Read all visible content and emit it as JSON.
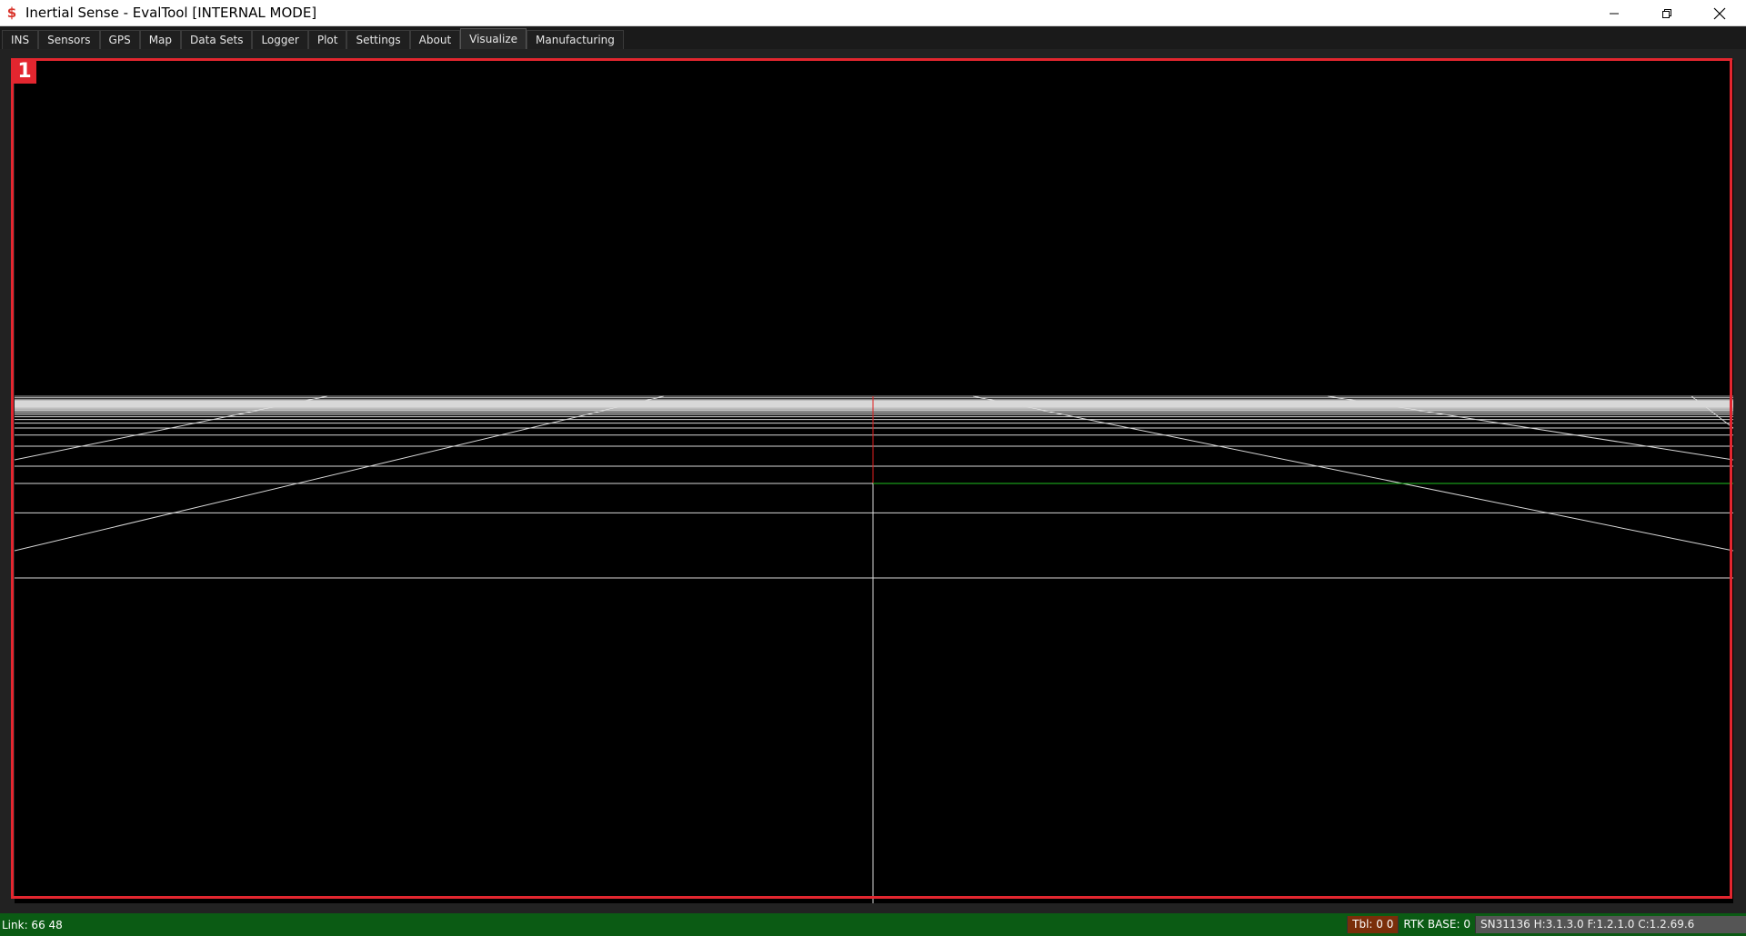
{
  "window": {
    "title": "Inertial Sense - EvalTool [INTERNAL MODE]",
    "icon": "inertial-sense-logo-icon"
  },
  "tabs": [
    {
      "label": "INS",
      "active": false
    },
    {
      "label": "Sensors",
      "active": false
    },
    {
      "label": "GPS",
      "active": false
    },
    {
      "label": "Map",
      "active": false
    },
    {
      "label": "Data Sets",
      "active": false
    },
    {
      "label": "Logger",
      "active": false
    },
    {
      "label": "Plot",
      "active": false
    },
    {
      "label": "Settings",
      "active": false
    },
    {
      "label": "About",
      "active": false
    },
    {
      "label": "Visualize",
      "active": true
    },
    {
      "label": "Manufacturing",
      "active": false
    }
  ],
  "annotation": {
    "marker_label": "1",
    "color": "#e3262f"
  },
  "status": {
    "link": "Link: 66 48",
    "tbl": "Tbl: 0 0",
    "rtk_base": "RTK BASE: 0",
    "serial": "SN31136 H:3.1.3.0  F:1.2.1.0  C:1.2.69.6"
  },
  "colors": {
    "status_bg": "#0b5b14",
    "grid": "#d8d8d8",
    "x_axis": "#e02020",
    "y_axis": "#20c020"
  }
}
